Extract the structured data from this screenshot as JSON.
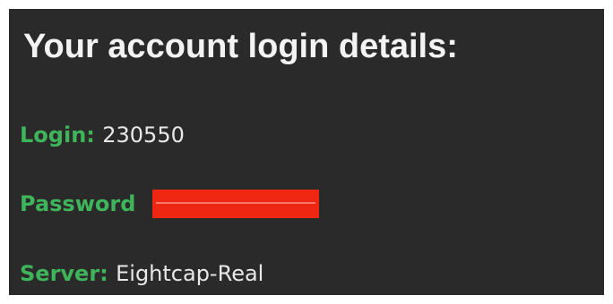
{
  "heading": "Your account login details:",
  "fields": {
    "login": {
      "label": "Login:",
      "value": "230550"
    },
    "password": {
      "label": "Password"
    },
    "server": {
      "label": "Server:",
      "value": "Eightcap-Real"
    }
  },
  "colors": {
    "background": "#2b2a2a",
    "label_accent": "#3fb55b",
    "text": "#e8e8e8",
    "redaction": "#ee2712"
  }
}
